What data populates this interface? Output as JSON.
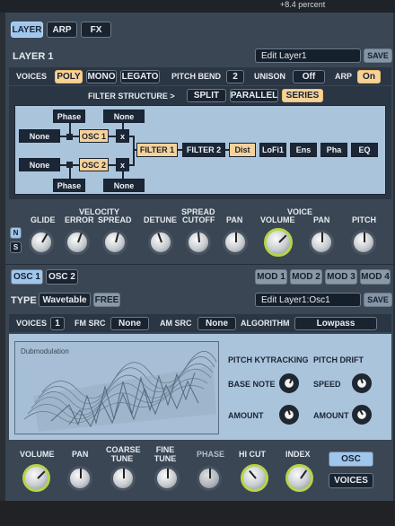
{
  "topbar": {
    "text": "+8.4 percent"
  },
  "tabs": [
    "LAYER",
    "ARP",
    "FX"
  ],
  "layer": {
    "title": "LAYER 1",
    "name_value": "Edit Layer1",
    "save_label": "SAVE"
  },
  "voices_row": {
    "voices_label": "VOICES",
    "modes": [
      "POLY",
      "MONO",
      "LEGATO"
    ],
    "pitch_bend_label": "PITCH BEND",
    "pitch_bend_value": "2",
    "unison_label": "UNISON",
    "unison_value": "Off",
    "arp_label": "ARP",
    "arp_value": "On"
  },
  "filter": {
    "structure_label": "FILTER STRUCTURE >",
    "structures": [
      "SPLIT",
      "PARALLEL",
      "SERIES"
    ],
    "nodes": {
      "phase_top": "Phase",
      "none_top": "None",
      "none_left1": "None",
      "osc1": "OSC 1",
      "x1": "x",
      "none_left2": "None",
      "osc2": "OSC 2",
      "x2": "x",
      "phase_bot": "Phase",
      "none_bot": "None",
      "filter1": "FILTER 1",
      "filter2": "FILTER 2",
      "dist": "Dist",
      "lofi": "LoFi1",
      "ens": "Ens",
      "pha": "Pha",
      "eq": "EQ"
    }
  },
  "knobs_row1": {
    "velocity_label": "VELOCITY",
    "spread_label": "SPREAD",
    "voice_label": "VOICE",
    "labels": [
      "GLIDE",
      "ERROR",
      "SPREAD",
      "DETUNE",
      "CUTOFF",
      "PAN",
      "VOLUME",
      "PAN",
      "PITCH"
    ],
    "side_buttons": [
      "N",
      "S"
    ]
  },
  "osc_tabs": [
    "OSC 1",
    "OSC 2"
  ],
  "mod_tabs": [
    "MOD 1",
    "MOD 2",
    "MOD 3",
    "MOD 4"
  ],
  "osc": {
    "type_label": "TYPE",
    "type_value": "Wavetable",
    "free_label": "FREE",
    "name_value": "Edit Layer1:Osc1",
    "save_label": "SAVE",
    "voices_label": "VOICES",
    "voices_value": "1",
    "fm_src_label": "FM SRC",
    "fm_src_value": "None",
    "am_src_label": "AM SRC",
    "am_src_value": "None",
    "algorithm_label": "ALGORITHM",
    "algorithm_value": "Lowpass",
    "wavetable_name": "Dubmodulation",
    "pitch_kytracking": "PITCH KYTRACKING",
    "pitch_drift": "PITCH DRIFT",
    "base_note": "BASE NOTE",
    "speed": "SPEED",
    "amount1": "AMOUNT",
    "amount2": "AMOUNT"
  },
  "bottom_knobs": {
    "labels": [
      "VOLUME",
      "PAN",
      "COARSE TUNE",
      "FINE TUNE",
      "PHASE",
      "HI CUT",
      "INDEX"
    ],
    "buttons": [
      "OSC",
      "VOICES"
    ]
  }
}
